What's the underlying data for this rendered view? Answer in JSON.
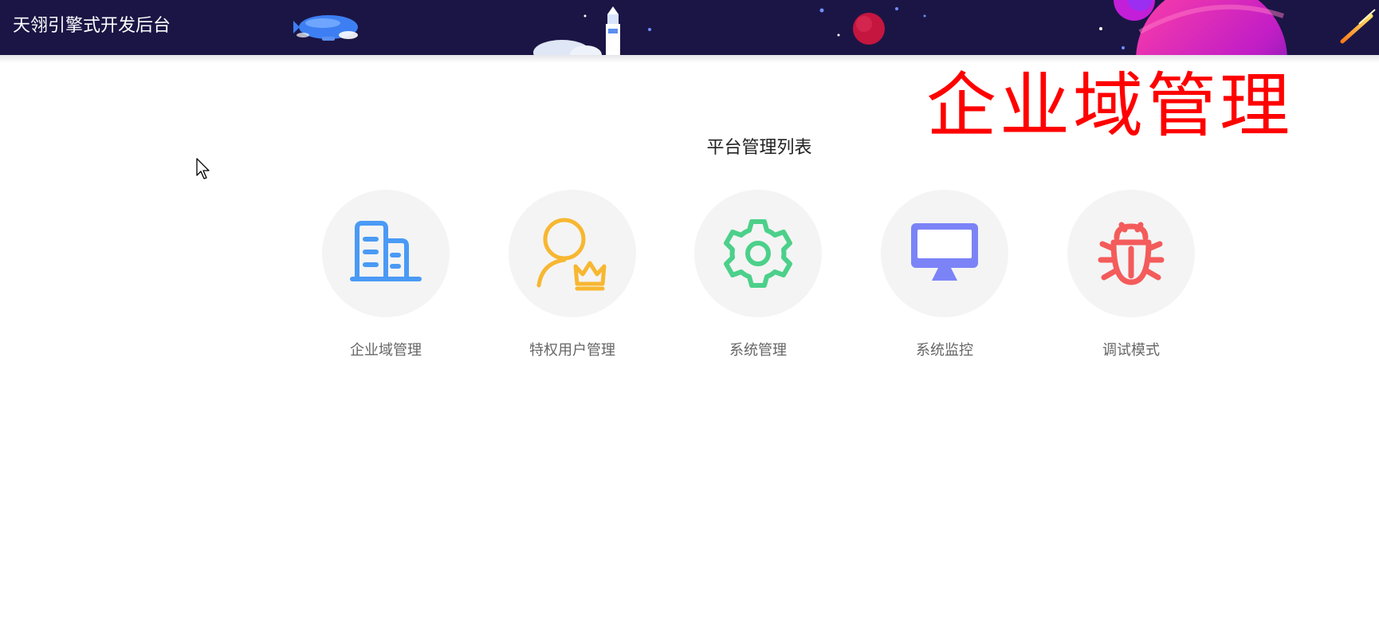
{
  "header": {
    "title": "天翎引擎式开发后台",
    "background": "#1b1545"
  },
  "overlay": {
    "text": "企业域管理",
    "color": "#ff0000"
  },
  "main": {
    "section_title": "平台管理列表",
    "items": [
      {
        "label": "企业域管理",
        "icon": "building-icon",
        "color": "#4a9af5"
      },
      {
        "label": "特权用户管理",
        "icon": "user-crown-icon",
        "color": "#f7b731"
      },
      {
        "label": "系统管理",
        "icon": "gear-icon",
        "color": "#4cd08a"
      },
      {
        "label": "系统监控",
        "icon": "monitor-icon",
        "color": "#7b83f7"
      },
      {
        "label": "调试模式",
        "icon": "bug-icon",
        "color": "#f45b5b"
      }
    ]
  }
}
